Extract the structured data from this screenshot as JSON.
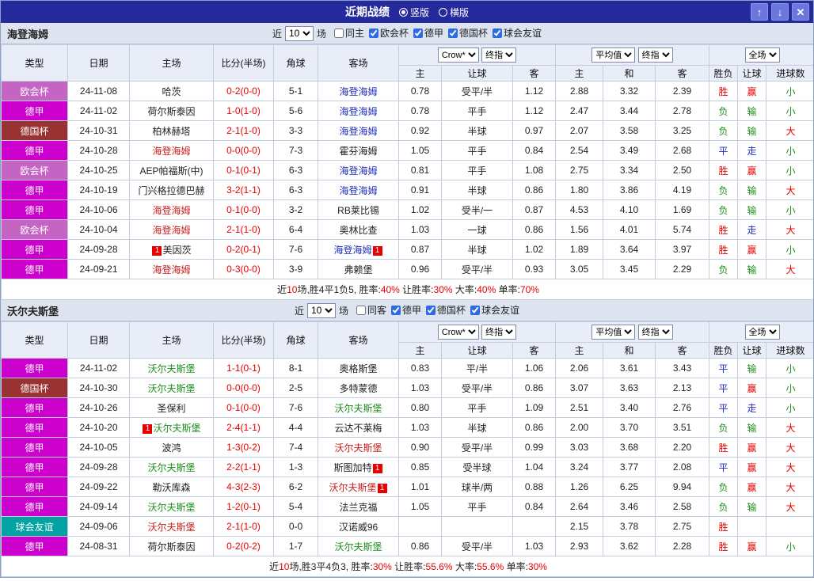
{
  "titlebar": {
    "title": "近期战绩",
    "radios": [
      {
        "label": "竖版",
        "selected": true
      },
      {
        "label": "横版",
        "selected": false
      }
    ],
    "buttons": {
      "up": "↑",
      "down": "↓",
      "close": "✕"
    }
  },
  "colors": {
    "titlebar_bg": "#24299b",
    "score": "#e60000",
    "type_bg": {
      "欧会杯": "#c465c4",
      "德甲": "#cc00cc",
      "德国杯": "#993333",
      "球会友谊": "#00a2a2"
    },
    "team": {
      "red": "#cc2020",
      "blue": "#1f2fbf",
      "green": "#1f8f1f"
    },
    "result": {
      "胜": "#e60000",
      "赢": "#e60000",
      "大": "#e60000",
      "负": "#1f8f1f",
      "输": "#1f8f1f",
      "小": "#1f8f1f",
      "平": "#1f2fbf",
      "走": "#1f2fbf"
    }
  },
  "sections": [
    {
      "team": "海登海姆",
      "near_label": "近",
      "near_count": "10",
      "games_label": "场",
      "filters": [
        {
          "label": "同主",
          "checked": false
        },
        {
          "label": "欧会杯",
          "checked": true
        },
        {
          "label": "德甲",
          "checked": true
        },
        {
          "label": "德国杯",
          "checked": true
        },
        {
          "label": "球会友谊",
          "checked": true
        }
      ],
      "columns": {
        "type": "类型",
        "date": "日期",
        "home": "主场",
        "score": "比分(半场)",
        "corner": "角球",
        "away": "客场",
        "odds_selects": [
          "Crow*",
          "终指"
        ],
        "odds_cols": [
          "主",
          "让球",
          "客"
        ],
        "avg_selects": [
          "平均值",
          "终指"
        ],
        "avg_cols": [
          "主",
          "和",
          "客"
        ],
        "result_select": "全场",
        "result_cols": [
          "胜负",
          "让球",
          "进球数"
        ]
      },
      "rows": [
        {
          "type": "欧会杯",
          "date": "24-11-08",
          "home": {
            "text": "哈茨"
          },
          "score": "0-2(0-0)",
          "corner": "5-1",
          "away": {
            "text": "海登海姆",
            "color": "blue"
          },
          "odds": [
            "0.78",
            "受平/半",
            "1.12"
          ],
          "avg": [
            "2.88",
            "3.32",
            "2.39"
          ],
          "results": [
            "胜",
            "赢",
            "小"
          ]
        },
        {
          "type": "德甲",
          "date": "24-11-02",
          "home": {
            "text": "荷尔斯泰因"
          },
          "score": "1-0(1-0)",
          "corner": "5-6",
          "away": {
            "text": "海登海姆",
            "color": "blue"
          },
          "odds": [
            "0.78",
            "平手",
            "1.12"
          ],
          "avg": [
            "2.47",
            "3.44",
            "2.78"
          ],
          "results": [
            "负",
            "输",
            "小"
          ]
        },
        {
          "type": "德国杯",
          "date": "24-10-31",
          "home": {
            "text": "柏林赫塔"
          },
          "score": "2-1(1-0)",
          "corner": "3-3",
          "away": {
            "text": "海登海姆",
            "color": "blue"
          },
          "odds": [
            "0.92",
            "半球",
            "0.97"
          ],
          "avg": [
            "2.07",
            "3.58",
            "3.25"
          ],
          "results": [
            "负",
            "输",
            "大"
          ]
        },
        {
          "type": "德甲",
          "date": "24-10-28",
          "home": {
            "text": "海登海姆",
            "color": "red"
          },
          "score": "0-0(0-0)",
          "corner": "7-3",
          "away": {
            "text": "霍芬海姆"
          },
          "odds": [
            "1.05",
            "平手",
            "0.84"
          ],
          "avg": [
            "2.54",
            "3.49",
            "2.68"
          ],
          "results": [
            "平",
            "走",
            "小"
          ]
        },
        {
          "type": "欧会杯",
          "date": "24-10-25",
          "home": {
            "text": "AEP帕福斯(中)"
          },
          "score": "0-1(0-1)",
          "corner": "6-3",
          "away": {
            "text": "海登海姆",
            "color": "blue"
          },
          "odds": [
            "0.81",
            "平手",
            "1.08"
          ],
          "avg": [
            "2.75",
            "3.34",
            "2.50"
          ],
          "results": [
            "胜",
            "赢",
            "小"
          ]
        },
        {
          "type": "德甲",
          "date": "24-10-19",
          "home": {
            "text": "门兴格拉德巴赫"
          },
          "score": "3-2(1-1)",
          "corner": "6-3",
          "away": {
            "text": "海登海姆",
            "color": "blue"
          },
          "odds": [
            "0.91",
            "半球",
            "0.86"
          ],
          "avg": [
            "1.80",
            "3.86",
            "4.19"
          ],
          "results": [
            "负",
            "输",
            "大"
          ]
        },
        {
          "type": "德甲",
          "date": "24-10-06",
          "home": {
            "text": "海登海姆",
            "color": "red"
          },
          "score": "0-1(0-0)",
          "corner": "3-2",
          "away": {
            "text": "RB莱比锡"
          },
          "odds": [
            "1.02",
            "受半/一",
            "0.87"
          ],
          "avg": [
            "4.53",
            "4.10",
            "1.69"
          ],
          "results": [
            "负",
            "输",
            "小"
          ]
        },
        {
          "type": "欧会杯",
          "date": "24-10-04",
          "home": {
            "text": "海登海姆",
            "color": "red"
          },
          "score": "2-1(1-0)",
          "corner": "6-4",
          "away": {
            "text": "奥林比查"
          },
          "odds": [
            "1.03",
            "一球",
            "0.86"
          ],
          "avg": [
            "1.56",
            "4.01",
            "5.74"
          ],
          "results": [
            "胜",
            "走",
            "大"
          ]
        },
        {
          "type": "德甲",
          "date": "24-09-28",
          "home": {
            "text": "美因茨",
            "badge_before": "1"
          },
          "score": "0-2(0-1)",
          "corner": "7-6",
          "away": {
            "text": "海登海姆",
            "color": "blue",
            "badge_after": "1"
          },
          "odds": [
            "0.87",
            "半球",
            "1.02"
          ],
          "avg": [
            "1.89",
            "3.64",
            "3.97"
          ],
          "results": [
            "胜",
            "赢",
            "小"
          ]
        },
        {
          "type": "德甲",
          "date": "24-09-21",
          "home": {
            "text": "海登海姆",
            "color": "red"
          },
          "score": "0-3(0-0)",
          "corner": "3-9",
          "away": {
            "text": "弗赖堡"
          },
          "odds": [
            "0.96",
            "受平/半",
            "0.93"
          ],
          "avg": [
            "3.05",
            "3.45",
            "2.29"
          ],
          "results": [
            "负",
            "输",
            "大"
          ]
        }
      ],
      "summary": [
        {
          "text": "近",
          "red": false
        },
        {
          "text": "10",
          "red": true
        },
        {
          "text": "场,胜4平1负5, ",
          "red": false
        },
        {
          "text": "胜率:",
          "red": false
        },
        {
          "text": "40%",
          "red": true
        },
        {
          "text": " 让胜率:",
          "red": false
        },
        {
          "text": "30%",
          "red": true
        },
        {
          "text": " 大率:",
          "red": false
        },
        {
          "text": "40%",
          "red": true
        },
        {
          "text": " 单率:",
          "red": false
        },
        {
          "text": "70%",
          "red": true
        }
      ]
    },
    {
      "team": "沃尔夫斯堡",
      "near_label": "近",
      "near_count": "10",
      "games_label": "场",
      "filters": [
        {
          "label": "同客",
          "checked": false
        },
        {
          "label": "德甲",
          "checked": true
        },
        {
          "label": "德国杯",
          "checked": true
        },
        {
          "label": "球会友谊",
          "checked": true
        }
      ],
      "columns": {
        "type": "类型",
        "date": "日期",
        "home": "主场",
        "score": "比分(半场)",
        "corner": "角球",
        "away": "客场",
        "odds_selects": [
          "Crow*",
          "终指"
        ],
        "odds_cols": [
          "主",
          "让球",
          "客"
        ],
        "avg_selects": [
          "平均值",
          "终指"
        ],
        "avg_cols": [
          "主",
          "和",
          "客"
        ],
        "result_select": "全场",
        "result_cols": [
          "胜负",
          "让球",
          "进球数"
        ]
      },
      "rows": [
        {
          "type": "德甲",
          "date": "24-11-02",
          "home": {
            "text": "沃尔夫斯堡",
            "color": "green"
          },
          "score": "1-1(0-1)",
          "corner": "8-1",
          "away": {
            "text": "奥格斯堡"
          },
          "odds": [
            "0.83",
            "平/半",
            "1.06"
          ],
          "avg": [
            "2.06",
            "3.61",
            "3.43"
          ],
          "results": [
            "平",
            "输",
            "小"
          ]
        },
        {
          "type": "德国杯",
          "date": "24-10-30",
          "home": {
            "text": "沃尔夫斯堡",
            "color": "green"
          },
          "score": "0-0(0-0)",
          "corner": "2-5",
          "away": {
            "text": "多特蒙德"
          },
          "odds": [
            "1.03",
            "受平/半",
            "0.86"
          ],
          "avg": [
            "3.07",
            "3.63",
            "2.13"
          ],
          "results": [
            "平",
            "赢",
            "小"
          ]
        },
        {
          "type": "德甲",
          "date": "24-10-26",
          "home": {
            "text": "圣保利"
          },
          "score": "0-1(0-0)",
          "corner": "7-6",
          "away": {
            "text": "沃尔夫斯堡",
            "color": "green"
          },
          "odds": [
            "0.80",
            "平手",
            "1.09"
          ],
          "avg": [
            "2.51",
            "3.40",
            "2.76"
          ],
          "results": [
            "平",
            "走",
            "小"
          ]
        },
        {
          "type": "德甲",
          "date": "24-10-20",
          "home": {
            "text": "沃尔夫斯堡",
            "color": "green",
            "badge_before": "1"
          },
          "score": "2-4(1-1)",
          "corner": "4-4",
          "away": {
            "text": "云达不莱梅"
          },
          "odds": [
            "1.03",
            "半球",
            "0.86"
          ],
          "avg": [
            "2.00",
            "3.70",
            "3.51"
          ],
          "results": [
            "负",
            "输",
            "大"
          ]
        },
        {
          "type": "德甲",
          "date": "24-10-05",
          "home": {
            "text": "波鸿"
          },
          "score": "1-3(0-2)",
          "corner": "7-4",
          "away": {
            "text": "沃尔夫斯堡",
            "color": "red"
          },
          "odds": [
            "0.90",
            "受平/半",
            "0.99"
          ],
          "avg": [
            "3.03",
            "3.68",
            "2.20"
          ],
          "results": [
            "胜",
            "赢",
            "大"
          ]
        },
        {
          "type": "德甲",
          "date": "24-09-28",
          "home": {
            "text": "沃尔夫斯堡",
            "color": "green"
          },
          "score": "2-2(1-1)",
          "corner": "1-3",
          "away": {
            "text": "斯图加特",
            "badge_after": "1"
          },
          "odds": [
            "0.85",
            "受半球",
            "1.04"
          ],
          "avg": [
            "3.24",
            "3.77",
            "2.08"
          ],
          "results": [
            "平",
            "赢",
            "大"
          ]
        },
        {
          "type": "德甲",
          "date": "24-09-22",
          "home": {
            "text": "勒沃库森"
          },
          "score": "4-3(2-3)",
          "corner": "6-2",
          "away": {
            "text": "沃尔夫斯堡",
            "color": "red",
            "badge_after": "1"
          },
          "odds": [
            "1.01",
            "球半/两",
            "0.88"
          ],
          "avg": [
            "1.26",
            "6.25",
            "9.94"
          ],
          "results": [
            "负",
            "赢",
            "大"
          ]
        },
        {
          "type": "德甲",
          "date": "24-09-14",
          "home": {
            "text": "沃尔夫斯堡",
            "color": "green"
          },
          "score": "1-2(0-1)",
          "corner": "5-4",
          "away": {
            "text": "法兰克福"
          },
          "odds": [
            "1.05",
            "平手",
            "0.84"
          ],
          "avg": [
            "2.64",
            "3.46",
            "2.58"
          ],
          "results": [
            "负",
            "输",
            "大"
          ]
        },
        {
          "type": "球会友谊",
          "date": "24-09-06",
          "home": {
            "text": "沃尔夫斯堡",
            "color": "red"
          },
          "score": "2-1(1-0)",
          "corner": "0-0",
          "away": {
            "text": "汉诺威96"
          },
          "odds": [
            "",
            "",
            ""
          ],
          "avg": [
            "2.15",
            "3.78",
            "2.75"
          ],
          "results": [
            "胜",
            "",
            ""
          ]
        },
        {
          "type": "德甲",
          "date": "24-08-31",
          "home": {
            "text": "荷尔斯泰因"
          },
          "score": "0-2(0-2)",
          "corner": "1-7",
          "away": {
            "text": "沃尔夫斯堡",
            "color": "green"
          },
          "odds": [
            "0.86",
            "受平/半",
            "1.03"
          ],
          "avg": [
            "2.93",
            "3.62",
            "2.28"
          ],
          "results": [
            "胜",
            "赢",
            "小"
          ]
        }
      ],
      "summary": [
        {
          "text": "近",
          "red": false
        },
        {
          "text": "10",
          "red": true
        },
        {
          "text": "场,胜3平4负3, ",
          "red": false
        },
        {
          "text": "胜率:",
          "red": false
        },
        {
          "text": "30%",
          "red": true
        },
        {
          "text": " 让胜率:",
          "red": false
        },
        {
          "text": "55.6%",
          "red": true
        },
        {
          "text": " 大率:",
          "red": false
        },
        {
          "text": "55.6%",
          "red": true
        },
        {
          "text": " 单率:",
          "red": false
        },
        {
          "text": "30%",
          "red": true
        }
      ]
    }
  ]
}
